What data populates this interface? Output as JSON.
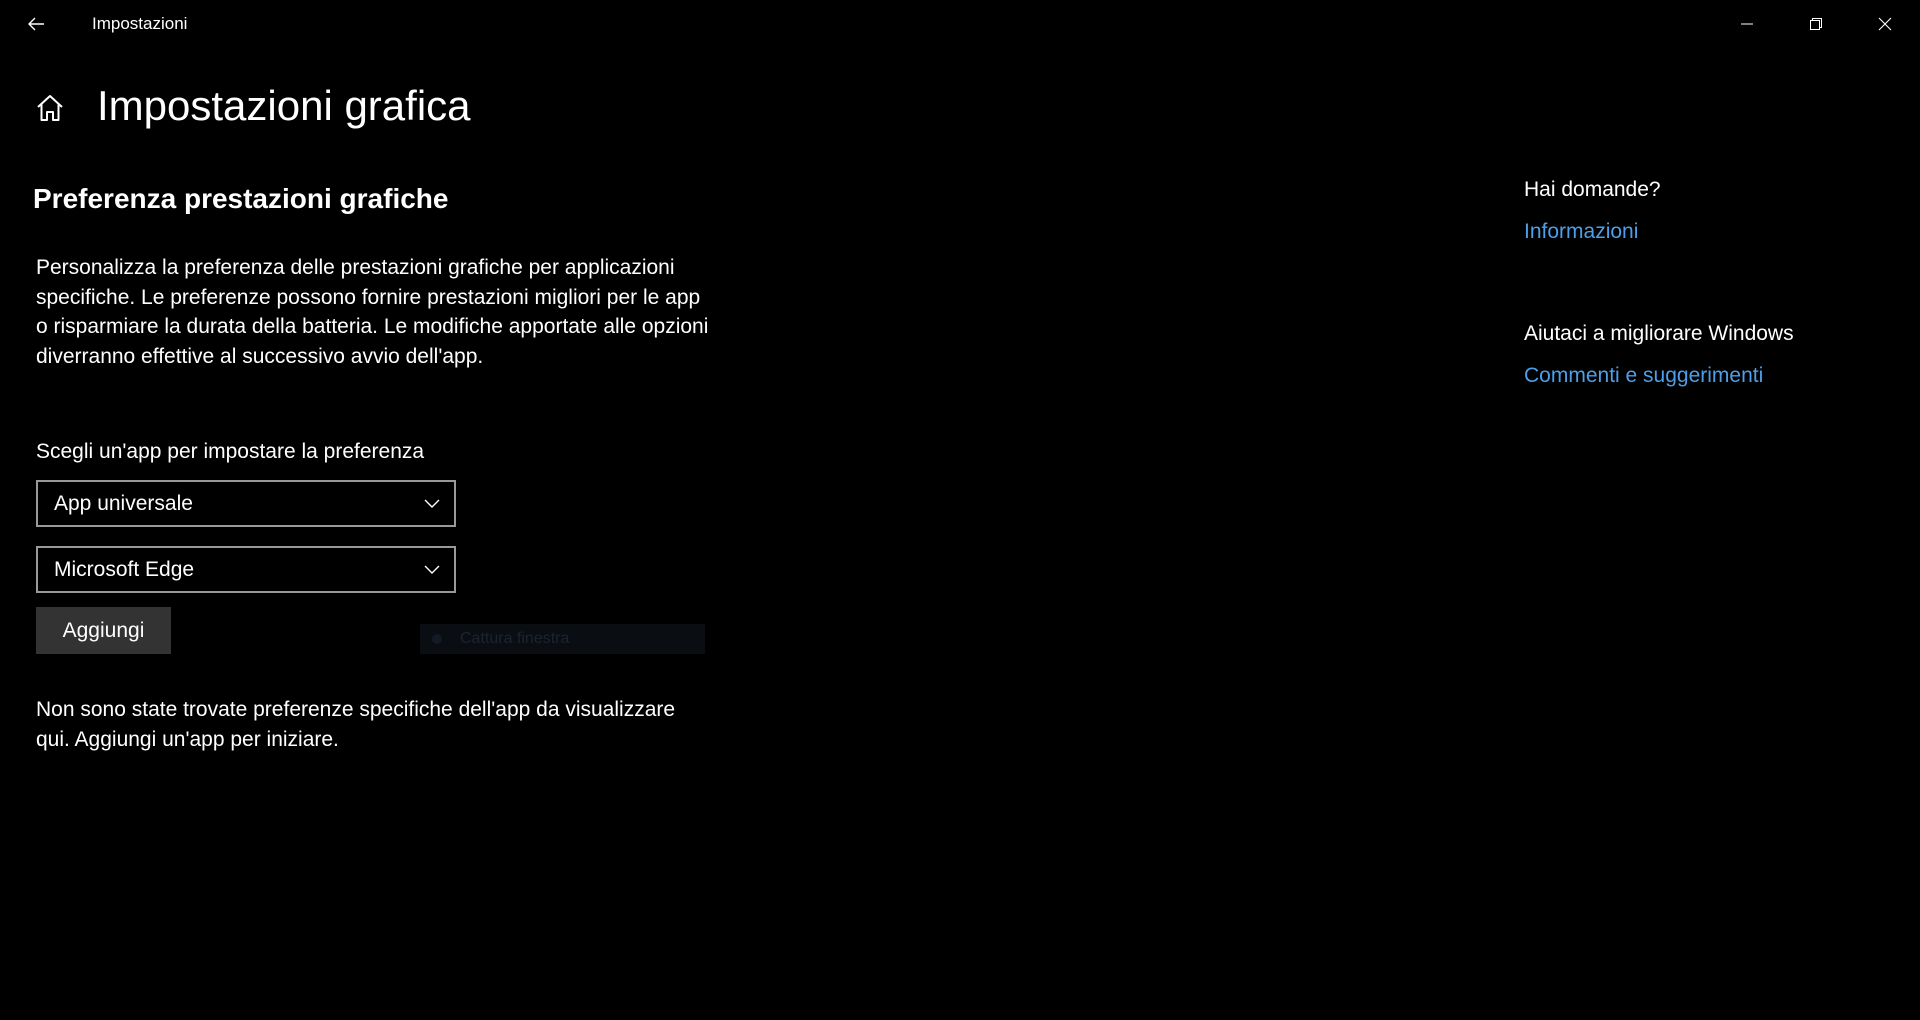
{
  "window": {
    "title": "Impostazioni"
  },
  "page": {
    "title": "Impostazioni grafica"
  },
  "main": {
    "section_title": "Preferenza prestazioni grafiche",
    "description": "Personalizza la preferenza delle prestazioni grafiche per applicazioni specifiche. Le preferenze possono fornire prestazioni migliori per le app o risparmiare la durata della batteria. Le modifiche apportate alle opzioni diverranno effettive al successivo avvio dell'app.",
    "choose_label": "Scegli un'app per impostare la preferenza",
    "app_type_dropdown": {
      "selected": "App universale"
    },
    "app_dropdown": {
      "selected": "Microsoft Edge"
    },
    "add_button_label": "Aggiungi",
    "faded_tooltip": "Cattura finestra",
    "empty_message": "Non sono state trovate preferenze specifiche dell'app da visualizzare qui. Aggiungi un'app per iniziare."
  },
  "sidebar": {
    "questions_heading": "Hai domande?",
    "questions_link": "Informazioni",
    "improve_heading": "Aiutaci a migliorare Windows",
    "improve_link": "Commenti e suggerimenti"
  },
  "colors": {
    "background": "#000000",
    "accent_link": "#4c9fe8",
    "button_bg": "#333333",
    "dropdown_border": "#999999"
  },
  "icons": {
    "back": "back-arrow-icon",
    "home": "home-icon",
    "minimize": "minimize-icon",
    "maximize": "restore-icon",
    "close": "close-icon",
    "dropdown": "chevron-down-icon"
  }
}
